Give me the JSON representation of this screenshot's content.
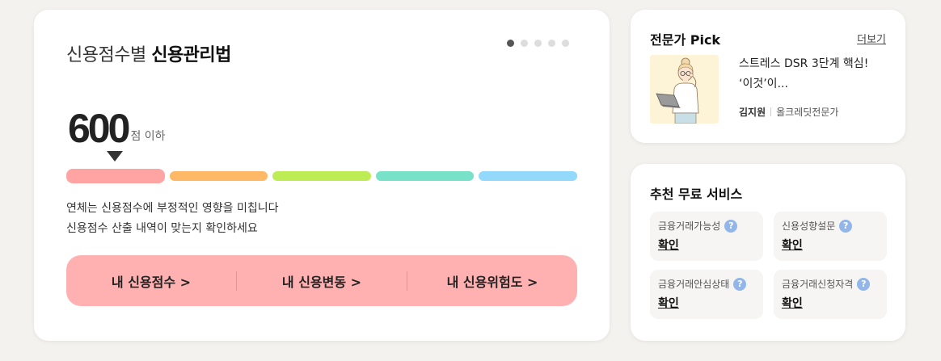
{
  "main": {
    "title_prefix": "신용점수별",
    "title_bold": "신용관리법",
    "pagination_count": 5,
    "pagination_active": 1,
    "score": "600",
    "score_unit": "점 이하",
    "bar_colors": [
      "#ffa3a3",
      "#ffb866",
      "#bdec55",
      "#77e2c8",
      "#92d9fc"
    ],
    "desc_lines": [
      "연체는 신용점수에 부정적인 영향을 미칩니다",
      "신용점수 산출 내역이 맞는지 확인하세요"
    ],
    "buttons": [
      "내 신용점수 >",
      "내 신용변동 >",
      "내 신용위험도 >"
    ]
  },
  "pick": {
    "title": "전문가 Pick",
    "more": "더보기",
    "article_title": "스트레스 DSR 3단계 핵심! ‘이것’이...",
    "author": "김지원",
    "role": "올크레딧전문가"
  },
  "services": {
    "title": "추천 무료 서비스",
    "items": [
      {
        "label": "금융거래가능성",
        "value": "확인"
      },
      {
        "label": "신용성향설문",
        "value": "확인"
      },
      {
        "label": "금융거래안심상태",
        "value": "확인"
      },
      {
        "label": "금융거래신청자격",
        "value": "확인"
      }
    ],
    "help_icon": "?"
  }
}
